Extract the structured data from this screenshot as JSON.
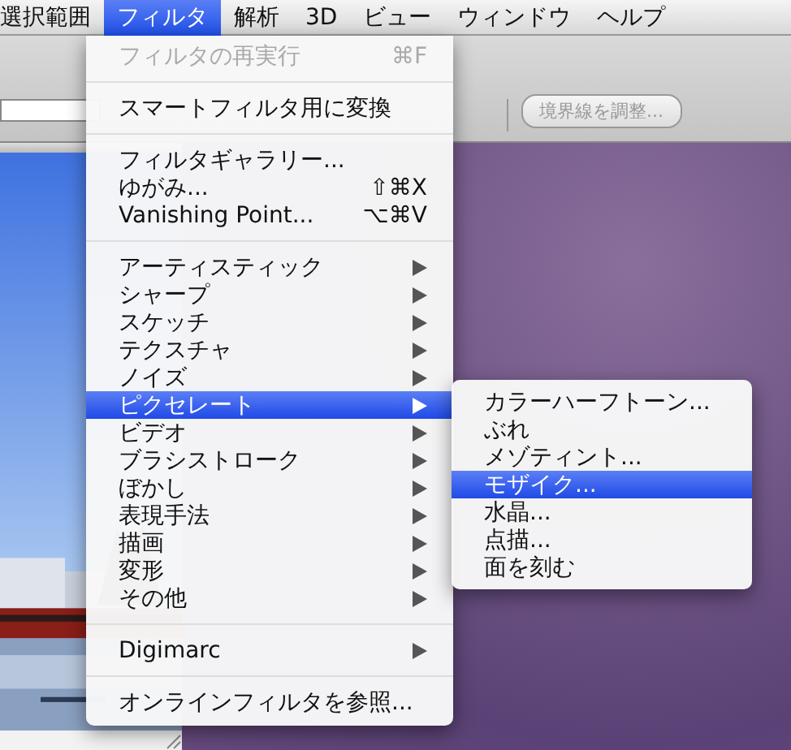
{
  "menubar": {
    "items": [
      {
        "label": "選択範囲",
        "selected": false
      },
      {
        "label": "フィルタ",
        "selected": true
      },
      {
        "label": "解析",
        "selected": false
      },
      {
        "label": "3D",
        "selected": false
      },
      {
        "label": "ビュー",
        "selected": false
      },
      {
        "label": "ウィンドウ",
        "selected": false
      },
      {
        "label": "ヘルプ",
        "selected": false
      }
    ]
  },
  "toolbar": {
    "button": {
      "label": "境界線を調整...",
      "disabled": true
    }
  },
  "menu": {
    "items": [
      {
        "kind": "item",
        "label": "フィルタの再実行",
        "shortcut": "⌘F",
        "disabled": true,
        "selected": false
      },
      {
        "kind": "separator"
      },
      {
        "kind": "item",
        "label": "スマートフィルタ用に変換",
        "disabled": false,
        "selected": false
      },
      {
        "kind": "separator"
      },
      {
        "kind": "item",
        "label": "フィルタギャラリー...",
        "disabled": false,
        "selected": false
      },
      {
        "kind": "item",
        "label": "ゆがみ...",
        "shortcut": "⇧⌘X",
        "disabled": false,
        "selected": false
      },
      {
        "kind": "item",
        "label": "Vanishing Point...",
        "shortcut": "⌥⌘V",
        "disabled": false,
        "selected": false
      },
      {
        "kind": "separator"
      },
      {
        "kind": "submenu",
        "label": "アーティスティック",
        "selected": false
      },
      {
        "kind": "submenu",
        "label": "シャープ",
        "selected": false
      },
      {
        "kind": "submenu",
        "label": "スケッチ",
        "selected": false
      },
      {
        "kind": "submenu",
        "label": "テクスチャ",
        "selected": false
      },
      {
        "kind": "submenu",
        "label": "ノイズ",
        "selected": false
      },
      {
        "kind": "submenu",
        "label": "ピクセレート",
        "selected": true
      },
      {
        "kind": "submenu",
        "label": "ビデオ",
        "selected": false
      },
      {
        "kind": "submenu",
        "label": "ブラシストローク",
        "selected": false
      },
      {
        "kind": "submenu",
        "label": "ぼかし",
        "selected": false
      },
      {
        "kind": "submenu",
        "label": "表現手法",
        "selected": false
      },
      {
        "kind": "submenu",
        "label": "描画",
        "selected": false
      },
      {
        "kind": "submenu",
        "label": "変形",
        "selected": false
      },
      {
        "kind": "submenu",
        "label": "その他",
        "selected": false
      },
      {
        "kind": "separator"
      },
      {
        "kind": "submenu",
        "label": "Digimarc",
        "selected": false
      },
      {
        "kind": "separator"
      },
      {
        "kind": "item",
        "label": "オンラインフィルタを参照...",
        "disabled": false,
        "selected": false
      }
    ]
  },
  "submenu": {
    "items": [
      {
        "label": "カラーハーフトーン...",
        "selected": false
      },
      {
        "label": "ぶれ",
        "selected": false
      },
      {
        "label": "メゾティント...",
        "selected": false
      },
      {
        "label": "モザイク...",
        "selected": true
      },
      {
        "label": "水晶...",
        "selected": false
      },
      {
        "label": "点描...",
        "selected": false
      },
      {
        "label": "面を刻む",
        "selected": false
      }
    ]
  }
}
